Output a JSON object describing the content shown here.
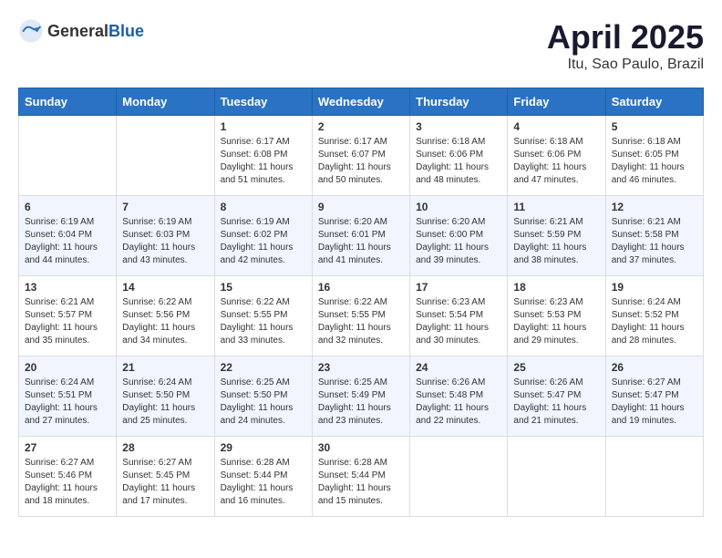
{
  "logo": {
    "general": "General",
    "blue": "Blue"
  },
  "title": "April 2025",
  "subtitle": "Itu, Sao Paulo, Brazil",
  "days_header": [
    "Sunday",
    "Monday",
    "Tuesday",
    "Wednesday",
    "Thursday",
    "Friday",
    "Saturday"
  ],
  "weeks": [
    [
      {
        "day": "",
        "info": ""
      },
      {
        "day": "",
        "info": ""
      },
      {
        "day": "1",
        "info": "Sunrise: 6:17 AM\nSunset: 6:08 PM\nDaylight: 11 hours and 51 minutes."
      },
      {
        "day": "2",
        "info": "Sunrise: 6:17 AM\nSunset: 6:07 PM\nDaylight: 11 hours and 50 minutes."
      },
      {
        "day": "3",
        "info": "Sunrise: 6:18 AM\nSunset: 6:06 PM\nDaylight: 11 hours and 48 minutes."
      },
      {
        "day": "4",
        "info": "Sunrise: 6:18 AM\nSunset: 6:06 PM\nDaylight: 11 hours and 47 minutes."
      },
      {
        "day": "5",
        "info": "Sunrise: 6:18 AM\nSunset: 6:05 PM\nDaylight: 11 hours and 46 minutes."
      }
    ],
    [
      {
        "day": "6",
        "info": "Sunrise: 6:19 AM\nSunset: 6:04 PM\nDaylight: 11 hours and 44 minutes."
      },
      {
        "day": "7",
        "info": "Sunrise: 6:19 AM\nSunset: 6:03 PM\nDaylight: 11 hours and 43 minutes."
      },
      {
        "day": "8",
        "info": "Sunrise: 6:19 AM\nSunset: 6:02 PM\nDaylight: 11 hours and 42 minutes."
      },
      {
        "day": "9",
        "info": "Sunrise: 6:20 AM\nSunset: 6:01 PM\nDaylight: 11 hours and 41 minutes."
      },
      {
        "day": "10",
        "info": "Sunrise: 6:20 AM\nSunset: 6:00 PM\nDaylight: 11 hours and 39 minutes."
      },
      {
        "day": "11",
        "info": "Sunrise: 6:21 AM\nSunset: 5:59 PM\nDaylight: 11 hours and 38 minutes."
      },
      {
        "day": "12",
        "info": "Sunrise: 6:21 AM\nSunset: 5:58 PM\nDaylight: 11 hours and 37 minutes."
      }
    ],
    [
      {
        "day": "13",
        "info": "Sunrise: 6:21 AM\nSunset: 5:57 PM\nDaylight: 11 hours and 35 minutes."
      },
      {
        "day": "14",
        "info": "Sunrise: 6:22 AM\nSunset: 5:56 PM\nDaylight: 11 hours and 34 minutes."
      },
      {
        "day": "15",
        "info": "Sunrise: 6:22 AM\nSunset: 5:55 PM\nDaylight: 11 hours and 33 minutes."
      },
      {
        "day": "16",
        "info": "Sunrise: 6:22 AM\nSunset: 5:55 PM\nDaylight: 11 hours and 32 minutes."
      },
      {
        "day": "17",
        "info": "Sunrise: 6:23 AM\nSunset: 5:54 PM\nDaylight: 11 hours and 30 minutes."
      },
      {
        "day": "18",
        "info": "Sunrise: 6:23 AM\nSunset: 5:53 PM\nDaylight: 11 hours and 29 minutes."
      },
      {
        "day": "19",
        "info": "Sunrise: 6:24 AM\nSunset: 5:52 PM\nDaylight: 11 hours and 28 minutes."
      }
    ],
    [
      {
        "day": "20",
        "info": "Sunrise: 6:24 AM\nSunset: 5:51 PM\nDaylight: 11 hours and 27 minutes."
      },
      {
        "day": "21",
        "info": "Sunrise: 6:24 AM\nSunset: 5:50 PM\nDaylight: 11 hours and 25 minutes."
      },
      {
        "day": "22",
        "info": "Sunrise: 6:25 AM\nSunset: 5:50 PM\nDaylight: 11 hours and 24 minutes."
      },
      {
        "day": "23",
        "info": "Sunrise: 6:25 AM\nSunset: 5:49 PM\nDaylight: 11 hours and 23 minutes."
      },
      {
        "day": "24",
        "info": "Sunrise: 6:26 AM\nSunset: 5:48 PM\nDaylight: 11 hours and 22 minutes."
      },
      {
        "day": "25",
        "info": "Sunrise: 6:26 AM\nSunset: 5:47 PM\nDaylight: 11 hours and 21 minutes."
      },
      {
        "day": "26",
        "info": "Sunrise: 6:27 AM\nSunset: 5:47 PM\nDaylight: 11 hours and 19 minutes."
      }
    ],
    [
      {
        "day": "27",
        "info": "Sunrise: 6:27 AM\nSunset: 5:46 PM\nDaylight: 11 hours and 18 minutes."
      },
      {
        "day": "28",
        "info": "Sunrise: 6:27 AM\nSunset: 5:45 PM\nDaylight: 11 hours and 17 minutes."
      },
      {
        "day": "29",
        "info": "Sunrise: 6:28 AM\nSunset: 5:44 PM\nDaylight: 11 hours and 16 minutes."
      },
      {
        "day": "30",
        "info": "Sunrise: 6:28 AM\nSunset: 5:44 PM\nDaylight: 11 hours and 15 minutes."
      },
      {
        "day": "",
        "info": ""
      },
      {
        "day": "",
        "info": ""
      },
      {
        "day": "",
        "info": ""
      }
    ]
  ]
}
